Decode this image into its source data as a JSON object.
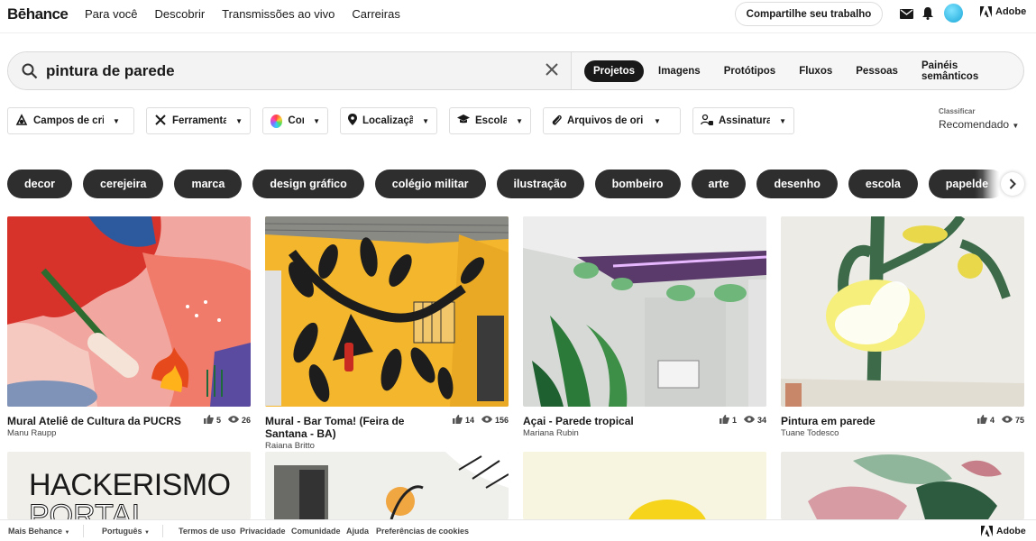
{
  "brand": "Bēhance",
  "nav": {
    "links": [
      "Para você",
      "Descobrir",
      "Transmissões ao vivo",
      "Carreiras"
    ],
    "share_label": "Compartilhe seu trabalho",
    "adobe_label": "Adobe"
  },
  "search": {
    "value": "pintura de parede",
    "tabs": [
      {
        "label": "Projetos",
        "active": true
      },
      {
        "label": "Imagens",
        "active": false
      },
      {
        "label": "Protótipos",
        "active": false
      },
      {
        "label": "Fluxos",
        "active": false
      },
      {
        "label": "Pessoas",
        "active": false
      },
      {
        "label": "Painéis semânticos",
        "active": false
      }
    ]
  },
  "filters": [
    {
      "label": "Campos de cri",
      "icon": "creative-fields-icon"
    },
    {
      "label": "Ferramentas",
      "icon": "tools-icon"
    },
    {
      "label": "Cor",
      "icon": "color-wheel-icon"
    },
    {
      "label": "Localização",
      "icon": "location-pin-icon"
    },
    {
      "label": "Escolas",
      "icon": "graduation-cap-icon"
    },
    {
      "label": "Arquivos de ori",
      "icon": "paperclip-icon"
    },
    {
      "label": "Assinaturas",
      "icon": "subscription-lock-icon"
    }
  ],
  "sort": {
    "label": "Classificar",
    "value": "Recomendado"
  },
  "chips": [
    "decor",
    "cerejeira",
    "marca",
    "design gráfico",
    "colégio militar",
    "ilustração",
    "bombeiro",
    "arte",
    "desenho",
    "escola",
    "papelde"
  ],
  "projects": [
    {
      "title": "Mural Ateliê de Cultura da PUCRS",
      "author": "Manu Raupp",
      "likes": "5",
      "views": "26"
    },
    {
      "title": "Mural - Bar Toma! (Feira de Santana - BA)",
      "author": "Raiana Britto",
      "likes": "14",
      "views": "156"
    },
    {
      "title": "Açai - Parede tropical",
      "author": "Mariana Rubin",
      "likes": "1",
      "views": "34"
    },
    {
      "title": "Pintura em parede",
      "author": "Tuane Todesco",
      "likes": "4",
      "views": "75"
    }
  ],
  "second_row": [
    {
      "thumb_text_1": "HACKERISMO",
      "thumb_text_2": "PORTAL"
    }
  ],
  "footer": {
    "links": [
      "Mais Behance",
      "Português",
      "Termos de uso",
      "Privacidade",
      "Comunidade",
      "Ajuda",
      "Preferências de cookies"
    ],
    "adobe_label": "Adobe"
  },
  "colors": {
    "chip_bg": "#2e2e2e",
    "active_tab_bg": "#191919",
    "avatar": "#1aa7d8"
  }
}
